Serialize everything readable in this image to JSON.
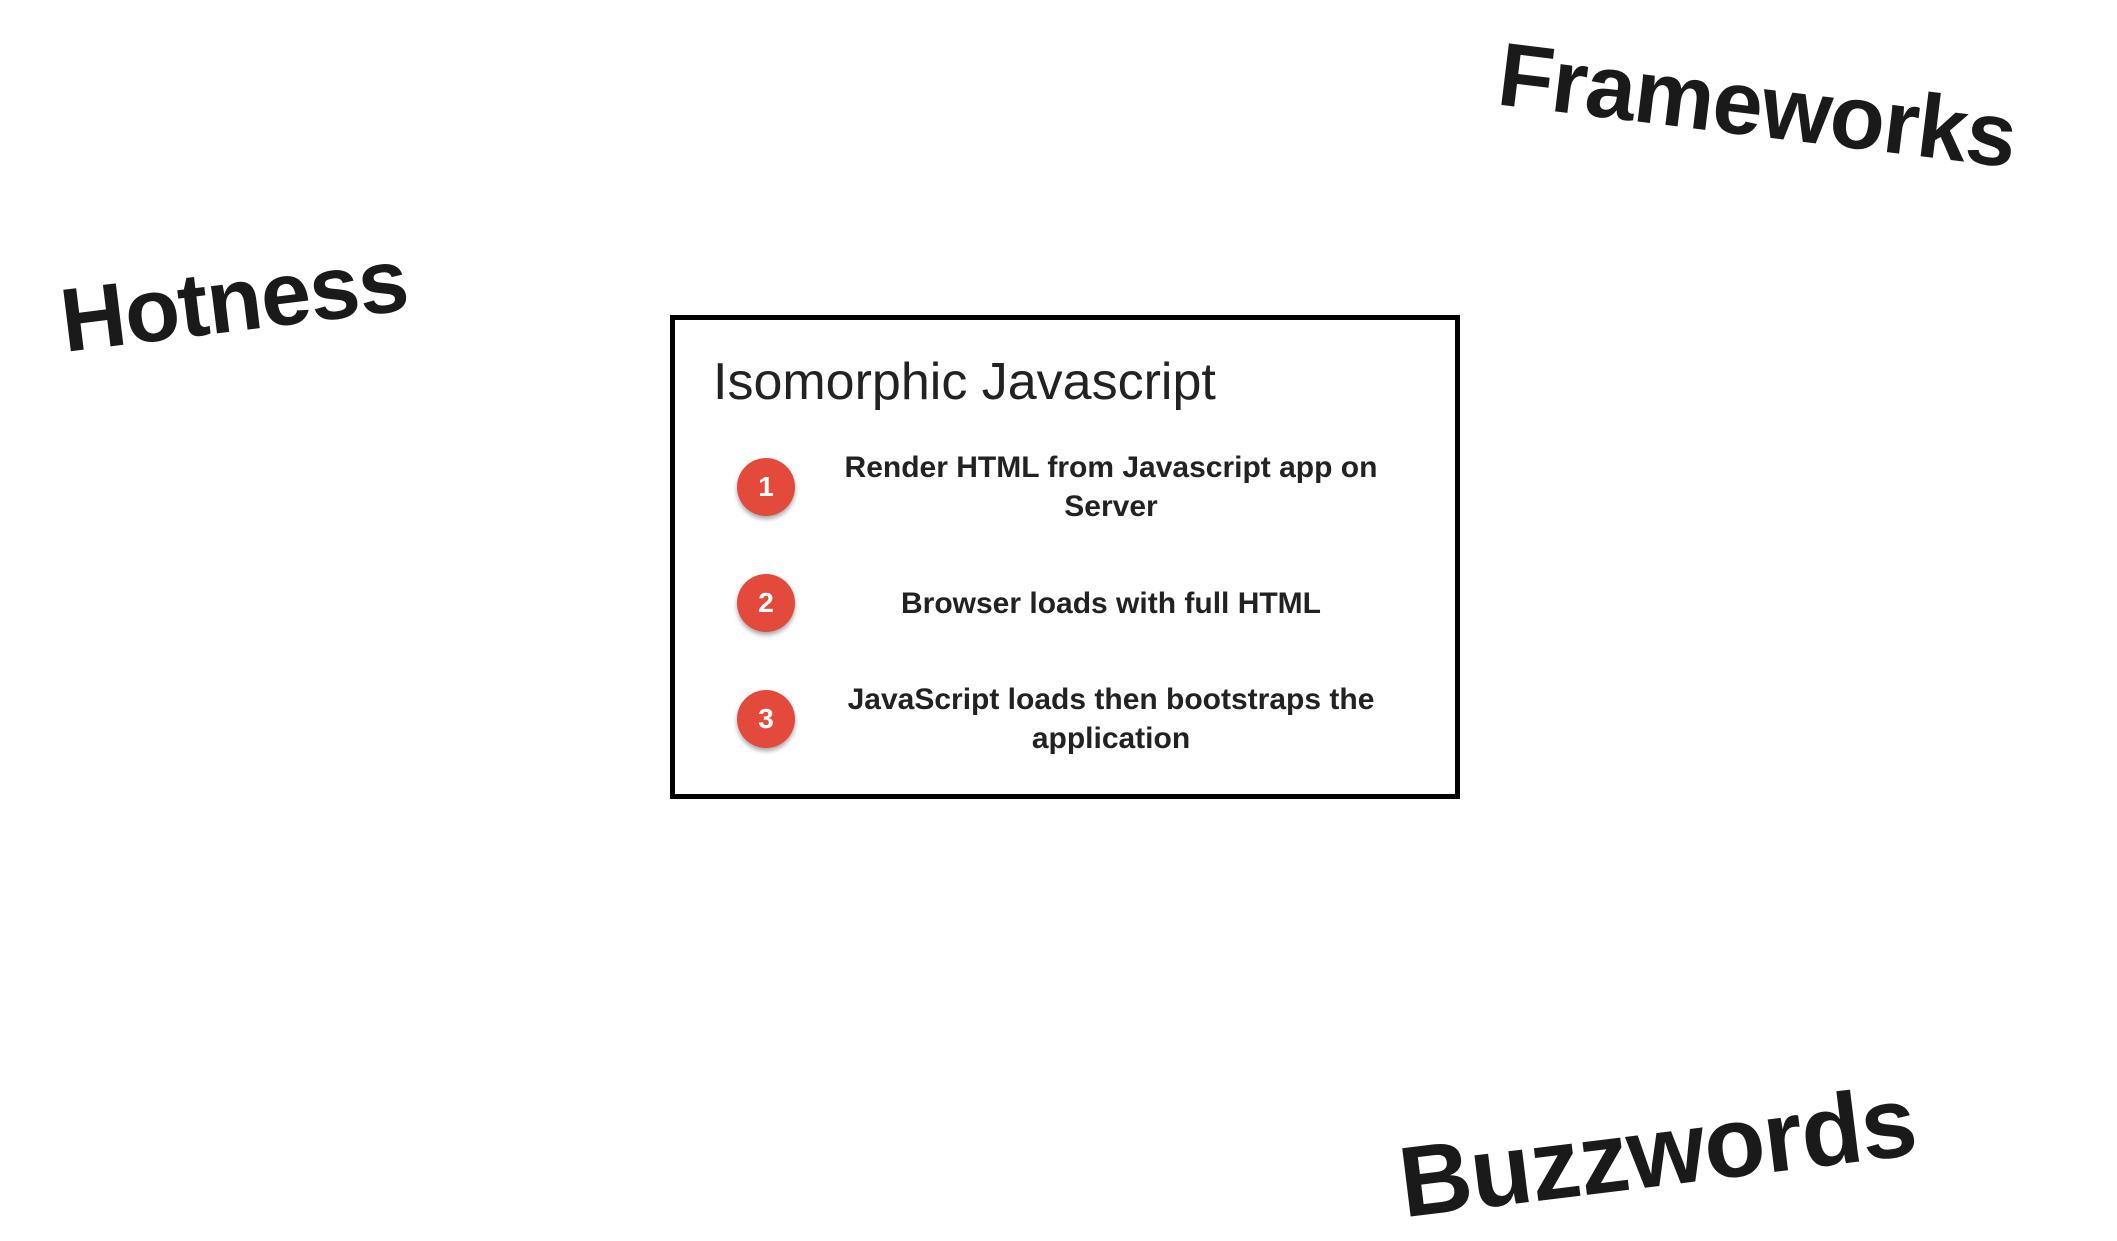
{
  "floating": {
    "hotness": "Hotness",
    "frameworks": "Frameworks",
    "buzzwords": "Buzzwords"
  },
  "card": {
    "title": "Isomorphic Javascript",
    "steps": [
      {
        "n": "1",
        "text": "Render HTML from Javascript app on Server"
      },
      {
        "n": "2",
        "text": "Browser loads with full HTML"
      },
      {
        "n": "3",
        "text": "JavaScript loads then bootstraps the application"
      }
    ]
  }
}
